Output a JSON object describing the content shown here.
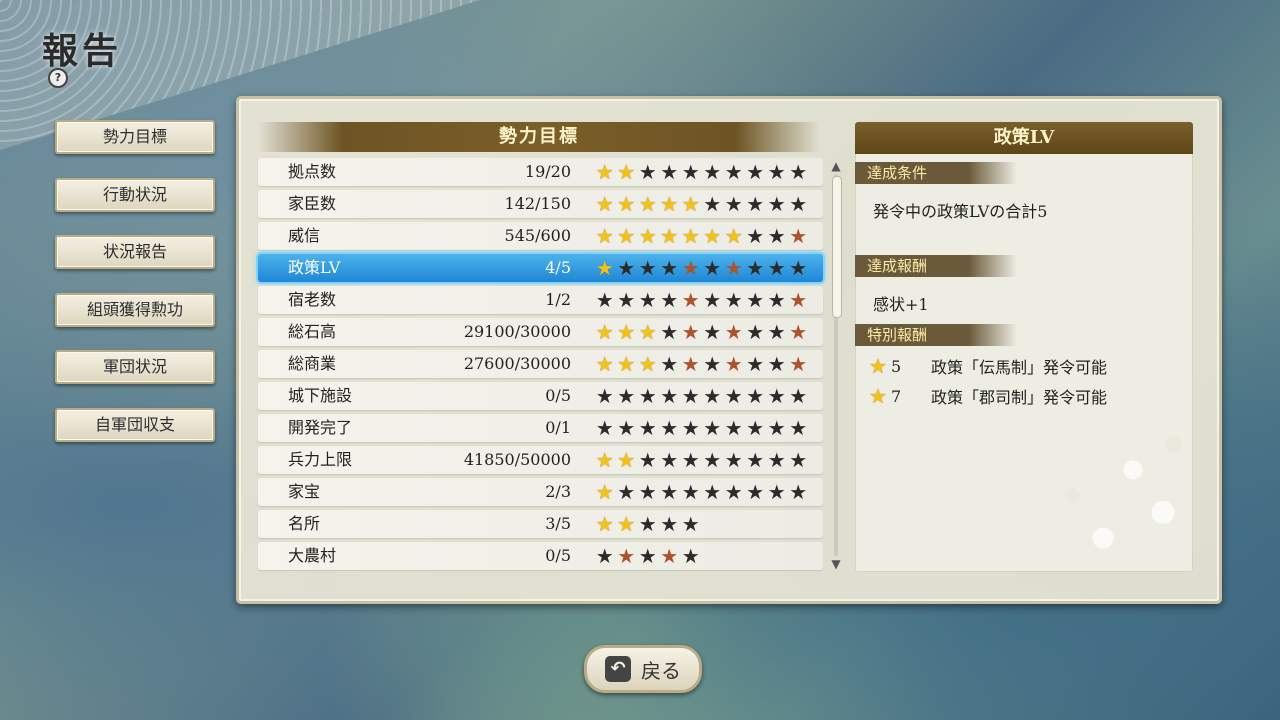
{
  "header": {
    "title": "報告",
    "help_icon": "?"
  },
  "menu": [
    {
      "label": "勢力目標",
      "active": true
    },
    {
      "label": "行動状況",
      "active": false
    },
    {
      "label": "状況報告",
      "active": false
    },
    {
      "label": "組頭獲得勲功",
      "active": false
    },
    {
      "label": "軍団状況",
      "active": false
    },
    {
      "label": "自軍団収支",
      "active": false
    }
  ],
  "list": {
    "title": "勢力目標",
    "rows": [
      {
        "name": "拠点数",
        "value": "19/20",
        "stars": "ggbbbbbbbb",
        "selected": false
      },
      {
        "name": "家臣数",
        "value": "142/150",
        "stars": "gggggbbbbb",
        "selected": false
      },
      {
        "name": "威信",
        "value": "545/600",
        "stars": "gggggggbbr",
        "selected": false
      },
      {
        "name": "政策LV",
        "value": "4/5",
        "stars": "gbbbrbrbbb",
        "selected": true
      },
      {
        "name": "宿老数",
        "value": "1/2",
        "stars": "bbbbrbbbbr",
        "selected": false
      },
      {
        "name": "総石高",
        "value": "29100/30000",
        "stars": "gggbrbrbbr",
        "selected": false
      },
      {
        "name": "総商業",
        "value": "27600/30000",
        "stars": "gggbrbrbbr",
        "selected": false
      },
      {
        "name": "城下施設",
        "value": "0/5",
        "stars": "bbbbbbbbbb",
        "selected": false
      },
      {
        "name": "開発完了",
        "value": "0/1",
        "stars": "bbbbbbbbbb",
        "selected": false
      },
      {
        "name": "兵力上限",
        "value": "41850/50000",
        "stars": "ggbbbbbbbb",
        "selected": false
      },
      {
        "name": "家宝",
        "value": "2/3",
        "stars": "gbbbbbbbbb",
        "selected": false
      },
      {
        "name": "名所",
        "value": "3/5",
        "stars": "ggbbb",
        "selected": false
      },
      {
        "name": "大農村",
        "value": "0/5",
        "stars": "brbrb",
        "selected": false
      }
    ]
  },
  "detail": {
    "title": "政策LV",
    "condition_label": "達成条件",
    "condition_text": "発令中の政策LVの合計5",
    "reward_label": "達成報酬",
    "reward_text": "感状+1",
    "special_label": "特別報酬",
    "special": [
      {
        "stars": "5",
        "text": "政策「伝馬制」発令可能"
      },
      {
        "stars": "7",
        "text": "政策「郡司制」発令可能"
      }
    ]
  },
  "footer": {
    "back_label": "戻る"
  },
  "colors": {
    "gold_star": "#f2c21c",
    "red_star": "#a9542a",
    "black_star": "#2b2b2b",
    "selected": "#1f86d6",
    "header_brown": "#6e5424"
  }
}
